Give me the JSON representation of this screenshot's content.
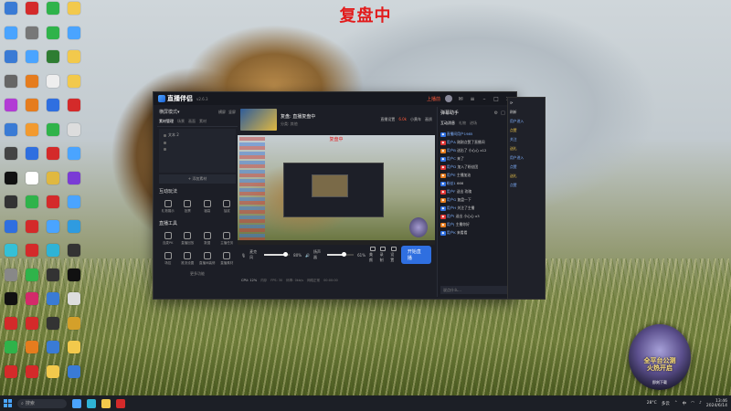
{
  "banner": "复盘中",
  "desktop_icons": [
    {
      "label": "",
      "color": "#3a7bd5"
    },
    {
      "label": "",
      "color": "#d42a2a"
    },
    {
      "label": "",
      "color": "#2fb34a"
    },
    {
      "label": "",
      "color": "#f2c94c"
    },
    {
      "label": "",
      "color": "#4aa4ff"
    },
    {
      "label": "",
      "color": "#777777"
    },
    {
      "label": "",
      "color": "#2fb34a"
    },
    {
      "label": "",
      "color": "#4aa4ff"
    },
    {
      "label": "",
      "color": "#3a7bd5"
    },
    {
      "label": "",
      "color": "#4aa4ff"
    },
    {
      "label": "",
      "color": "#2e7d32"
    },
    {
      "label": "",
      "color": "#f2c94c"
    },
    {
      "label": "",
      "color": "#666666"
    },
    {
      "label": "",
      "color": "#e57c1e"
    },
    {
      "label": "",
      "color": "#eeeeee"
    },
    {
      "label": "",
      "color": "#f2c94c"
    },
    {
      "label": "",
      "color": "#b23bd5"
    },
    {
      "label": "",
      "color": "#e57c1e"
    },
    {
      "label": "",
      "color": "#2f6fe0"
    },
    {
      "label": "",
      "color": "#d42a2a"
    },
    {
      "label": "",
      "color": "#3a7bd5"
    },
    {
      "label": "",
      "color": "#f29a2f"
    },
    {
      "label": "",
      "color": "#2fb34a"
    },
    {
      "label": "",
      "color": "#dddddd"
    },
    {
      "label": "",
      "color": "#444444"
    },
    {
      "label": "",
      "color": "#2f6fe0"
    },
    {
      "label": "",
      "color": "#d42a2a"
    },
    {
      "label": "",
      "color": "#4aa4ff"
    },
    {
      "label": "",
      "color": "#111111"
    },
    {
      "label": "",
      "color": "#ffffff"
    },
    {
      "label": "",
      "color": "#e0b840"
    },
    {
      "label": "",
      "color": "#7a3bd5"
    },
    {
      "label": "",
      "color": "#333333"
    },
    {
      "label": "",
      "color": "#2fb34a"
    },
    {
      "label": "",
      "color": "#d42a2a"
    },
    {
      "label": "",
      "color": "#4aa4ff"
    },
    {
      "label": "",
      "color": "#2f6fe0"
    },
    {
      "label": "",
      "color": "#d42a2a"
    },
    {
      "label": "",
      "color": "#4aa4ff"
    },
    {
      "label": "",
      "color": "#2f9be0"
    },
    {
      "label": "",
      "color": "#35c0d6"
    },
    {
      "label": "",
      "color": "#d42a2a"
    },
    {
      "label": "",
      "color": "#2fb3d6"
    },
    {
      "label": "",
      "color": "#333333"
    },
    {
      "label": "",
      "color": "#888888"
    },
    {
      "label": "",
      "color": "#2fb34a"
    },
    {
      "label": "",
      "color": "#333333"
    },
    {
      "label": "",
      "color": "#111111"
    },
    {
      "label": "",
      "color": "#111111"
    },
    {
      "label": "",
      "color": "#d42a6a"
    },
    {
      "label": "",
      "color": "#3a7bd5"
    },
    {
      "label": "",
      "color": "#dddddd"
    },
    {
      "label": "",
      "color": "#d42a2a"
    },
    {
      "label": "",
      "color": "#d42a2a"
    },
    {
      "label": "",
      "color": "#333333"
    },
    {
      "label": "",
      "color": "#d4a02a"
    },
    {
      "label": "",
      "color": "#2fb34a"
    },
    {
      "label": "",
      "color": "#e57c1e"
    },
    {
      "label": "",
      "color": "#3a7bd5"
    },
    {
      "label": "",
      "color": "#f2c94c"
    },
    {
      "label": "",
      "color": "#d42a2a"
    },
    {
      "label": "",
      "color": "#d42a2a"
    },
    {
      "label": "",
      "color": "#f2c94c"
    },
    {
      "label": "",
      "color": "#3a7bd5"
    }
  ],
  "app": {
    "logo": "直播伴侣",
    "version": "v2.6.3",
    "live_label": "上播前",
    "mode": "横屏模式",
    "mode_actions": [
      "横屏",
      "竖屏"
    ],
    "source_tabs": [
      "素材管理",
      "场景",
      "画面",
      "素材"
    ],
    "scenes": [
      "文本 2",
      "",
      ""
    ],
    "add_source": "添加素材",
    "section_interact": "互动玩法",
    "interact_tools": [
      "礼物展示",
      "投票",
      "福袋",
      "抽奖"
    ],
    "section_tools": "直播工具",
    "live_tools": [
      "连麦PK",
      "直播回放",
      "数据",
      "主播任务",
      "场控",
      "推流设置",
      "直播间装修",
      "直播素材"
    ],
    "more_tools": "更多功能",
    "stream_title": "复盘: 直播复盘中",
    "stream_sub": "分类: 其他",
    "head_actions": [
      "直播设置",
      "6.0k",
      "小黄车",
      "画质"
    ],
    "preview_banner": "复盘中",
    "vol_label": "麦克风",
    "vol_value": "80%",
    "vol_fill": 0.8,
    "spk_label": "扬声器",
    "spk_value": "61%",
    "spk_fill": 0.61,
    "ctrl_icons": [
      "美颜",
      "录制",
      "设置"
    ],
    "start_button": "开始直播",
    "status_items": [
      "CPU: 12%",
      "内存",
      "FPS: 30",
      "码率: 0kb/s",
      "网络正常",
      "00:00:00"
    ],
    "chat_title": "弹幕助手",
    "chat_actions": [
      "⚙",
      "□",
      "×"
    ],
    "chat_tabs": [
      "互动消息",
      "礼物",
      "进场"
    ],
    "chat_lines": [
      {
        "user": "直播间用户1985",
        "text": ""
      },
      {
        "user": "用户A",
        "text": "刚刚点赞了直播间"
      },
      {
        "user": "用户B",
        "text": "送出了 小心心 x12"
      },
      {
        "user": "用户C",
        "text": "来了"
      },
      {
        "user": "用户D",
        "text": "加入了粉丝团"
      },
      {
        "user": "用户E",
        "text": "主播加油"
      },
      {
        "user": "粉丝1",
        "text": "666"
      },
      {
        "user": "用户F",
        "text": "送出 玫瑰"
      },
      {
        "user": "用户G",
        "text": "复盘一下"
      },
      {
        "user": "用户H",
        "text": "关注了主播"
      },
      {
        "user": "用户I",
        "text": "送出 小心心 x3"
      },
      {
        "user": "用户J",
        "text": "主播你好"
      },
      {
        "user": "用户K",
        "text": "来看看"
      }
    ],
    "chat_footer": "说点什么…"
  },
  "app2_lines": [
    "刷新",
    "用户进入",
    "点赞",
    "关注",
    "送礼",
    "用户进入",
    "点赞",
    "送礼",
    "点赞"
  ],
  "promo": {
    "title": "全平台公测\n火热开启",
    "sub": "即刻下载"
  },
  "taskbar": {
    "search": "搜索",
    "tray_temp": "28°C",
    "tray_weather": "多云",
    "time": "13:46",
    "date": "2024/6/14",
    "lang": "中"
  }
}
